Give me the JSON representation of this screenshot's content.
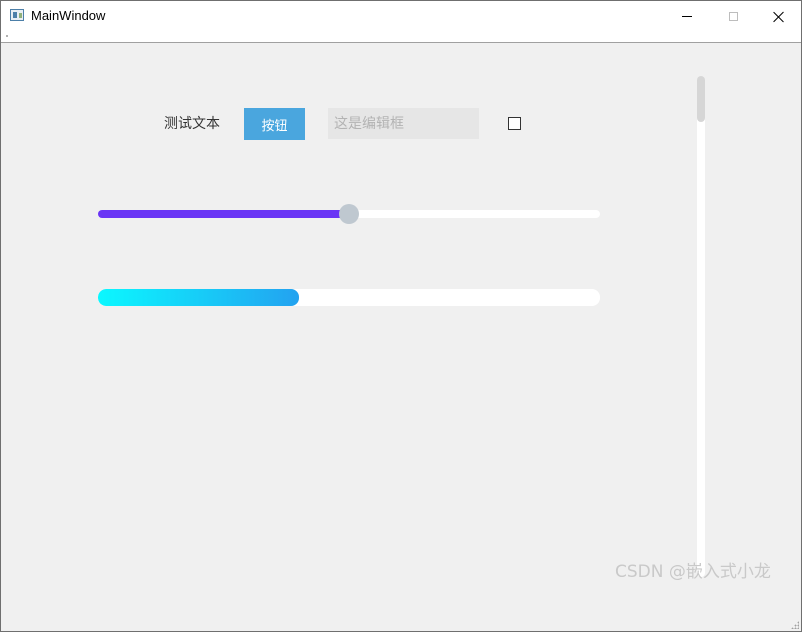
{
  "window": {
    "title": "MainWindow",
    "controls": {
      "minimize": "minimize",
      "maximize": "maximize",
      "close": "close"
    }
  },
  "form": {
    "label_text": "测试文本",
    "button_label": "按钮",
    "edit_placeholder": "这是编辑框",
    "edit_value": "",
    "checkbox_checked": false
  },
  "slider": {
    "value_fraction": 0.5,
    "fill_color": "#6a35f5",
    "handle_color": "#bfc8d0"
  },
  "progress": {
    "value_fraction": 0.4,
    "gradient_start": "#0bf8ff",
    "gradient_end": "#23a2f0"
  },
  "scrollbar": {
    "position_fraction": 0.0
  },
  "watermark": "CSDN @嵌入式小龙",
  "icons": {
    "app": "window-app-icon",
    "checkbox": "checkbox-unchecked-icon"
  }
}
